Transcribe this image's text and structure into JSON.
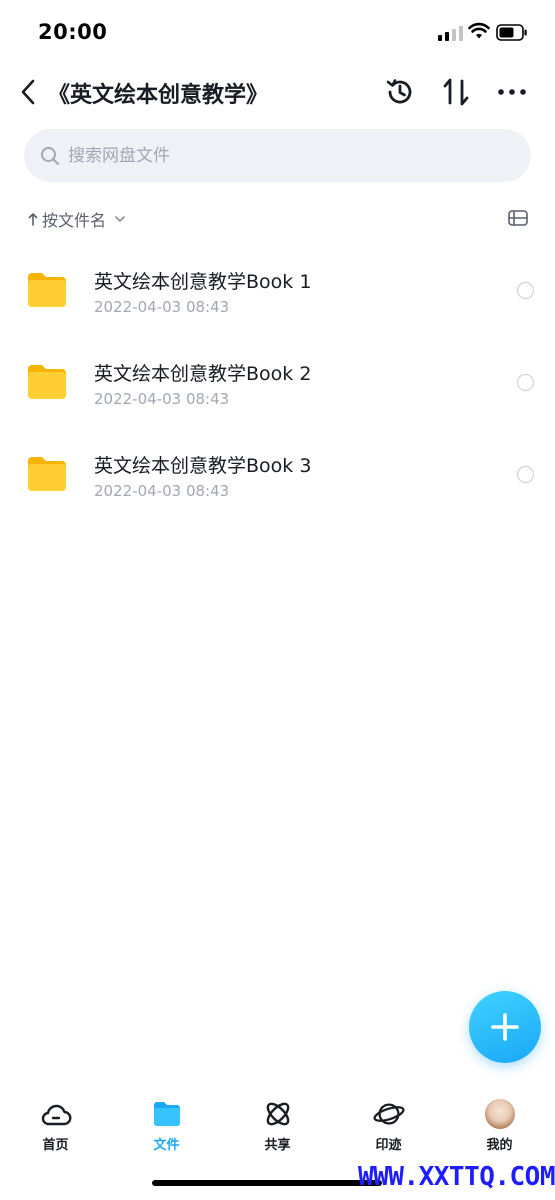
{
  "status_bar": {
    "time": "20:00"
  },
  "header": {
    "title": "《英文绘本创意教学》"
  },
  "search": {
    "placeholder": "搜索网盘文件"
  },
  "sort": {
    "label": "按文件名"
  },
  "files": [
    {
      "name": "英文绘本创意教学Book 1",
      "date": "2022-04-03 08:43"
    },
    {
      "name": "英文绘本创意教学Book 2",
      "date": "2022-04-03 08:43"
    },
    {
      "name": "英文绘本创意教学Book 3",
      "date": "2022-04-03 08:43"
    }
  ],
  "tabs": [
    {
      "label": "首页",
      "icon": "cloud-icon"
    },
    {
      "label": "文件",
      "icon": "folder-icon",
      "active": true
    },
    {
      "label": "共享",
      "icon": "share-orbit-icon"
    },
    {
      "label": "印迹",
      "icon": "planet-icon"
    },
    {
      "label": "我的",
      "icon": "avatar"
    }
  ],
  "watermark": "WWW.XXTTQ.COM",
  "colors": {
    "accent": "#1aa7f5",
    "folder": "#ffc928",
    "search_bg": "#f0f1f6"
  }
}
